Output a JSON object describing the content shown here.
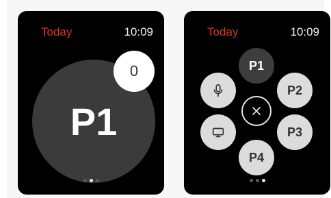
{
  "watch1": {
    "today_label": "Today",
    "time": "10:09",
    "main_label": "P1",
    "badge_count": "0",
    "page_indicator": {
      "total": 3,
      "active": 2
    }
  },
  "watch2": {
    "today_label": "Today",
    "time": "10:09",
    "buttons": {
      "p1": "P1",
      "p2": "P2",
      "p3": "P3",
      "p4": "P4",
      "mic_icon": "microphone-icon",
      "monitor_icon": "monitor-icon",
      "close_icon": "close-icon"
    },
    "page_indicator": {
      "total": 3,
      "active": 3
    }
  },
  "colors": {
    "accent_today": "#c53a34",
    "watch_bg": "#000000",
    "dark_circle": "#3b3b3b",
    "light_circle": "#dcdcdc",
    "badge_bg": "#ffffff"
  }
}
